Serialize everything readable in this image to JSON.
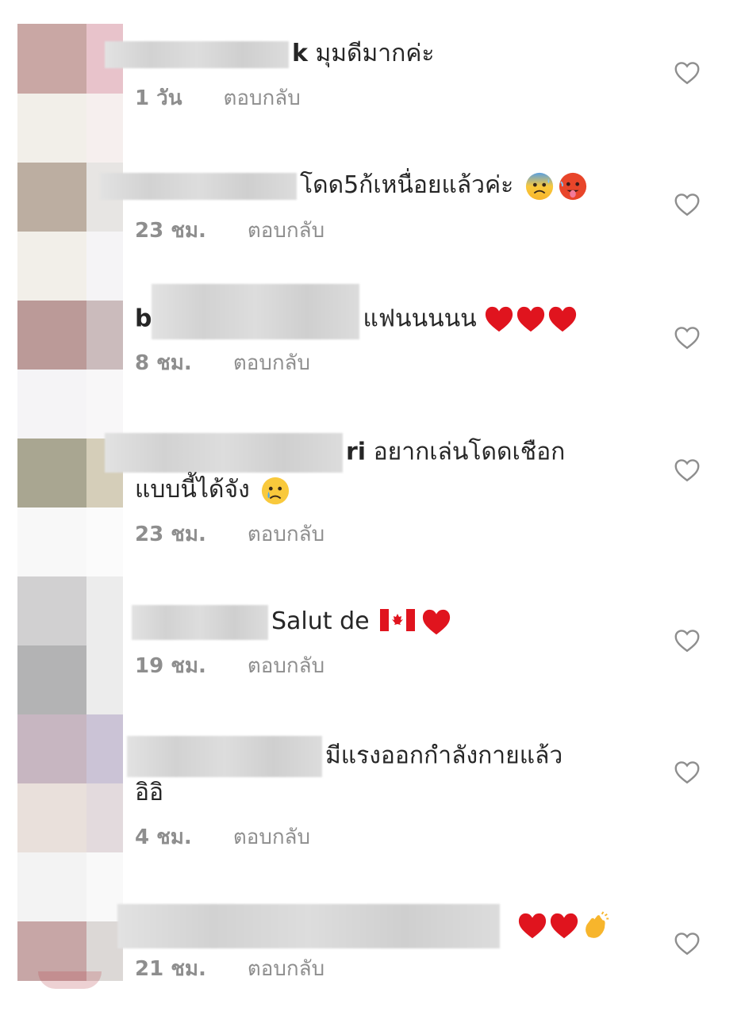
{
  "comments": [
    {
      "username_visible": "k",
      "text": "มุมดีมากค่ะ",
      "time": "1 วัน",
      "reply_label": "ตอบกลับ",
      "emojis": []
    },
    {
      "username_visible": "",
      "text": "โดด5ก้เหนื่อยแล้วค่ะ",
      "time": "23 ชม.",
      "reply_label": "ตอบกลับ",
      "emojis": [
        "anxious-sweat-face-emoji",
        "hot-face-emoji"
      ]
    },
    {
      "username_visible": "b",
      "text": "แฟนนนนน",
      "time": "8 ชม.",
      "reply_label": "ตอบกลับ",
      "emojis": [
        "red-heart-emoji",
        "red-heart-emoji",
        "red-heart-emoji"
      ]
    },
    {
      "username_visible": "ri",
      "text": "อยากเล่นโดดเชือก",
      "text_line2": "แบบนี้ได้จัง",
      "time": "23 ชม.",
      "reply_label": "ตอบกลับ",
      "emojis": [
        "crying-face-emoji"
      ]
    },
    {
      "username_visible": "",
      "text": "Salut de",
      "time": "19 ชม.",
      "reply_label": "ตอบกลับ",
      "emojis": [
        "canada-flag-emoji",
        "red-heart-emoji"
      ]
    },
    {
      "username_visible": "",
      "text": "มีแรงออกกำลังกายแล้ว",
      "text_line2": "อิอิ",
      "time": "4 ชม.",
      "reply_label": "ตอบกลับ",
      "emojis": []
    },
    {
      "username_visible": "",
      "text": "",
      "time": "21 ชม.",
      "reply_label": "ตอบกลับ",
      "emojis": [
        "red-heart-emoji",
        "red-heart-emoji",
        "clapping-hands-emoji"
      ]
    }
  ],
  "colors": {
    "text": "#262626",
    "meta": "#8e8e8e",
    "heart_outline": "#8e8e8e",
    "emoji_heart": "#e0141e"
  },
  "icons": {
    "like": "heart-outline-icon"
  }
}
